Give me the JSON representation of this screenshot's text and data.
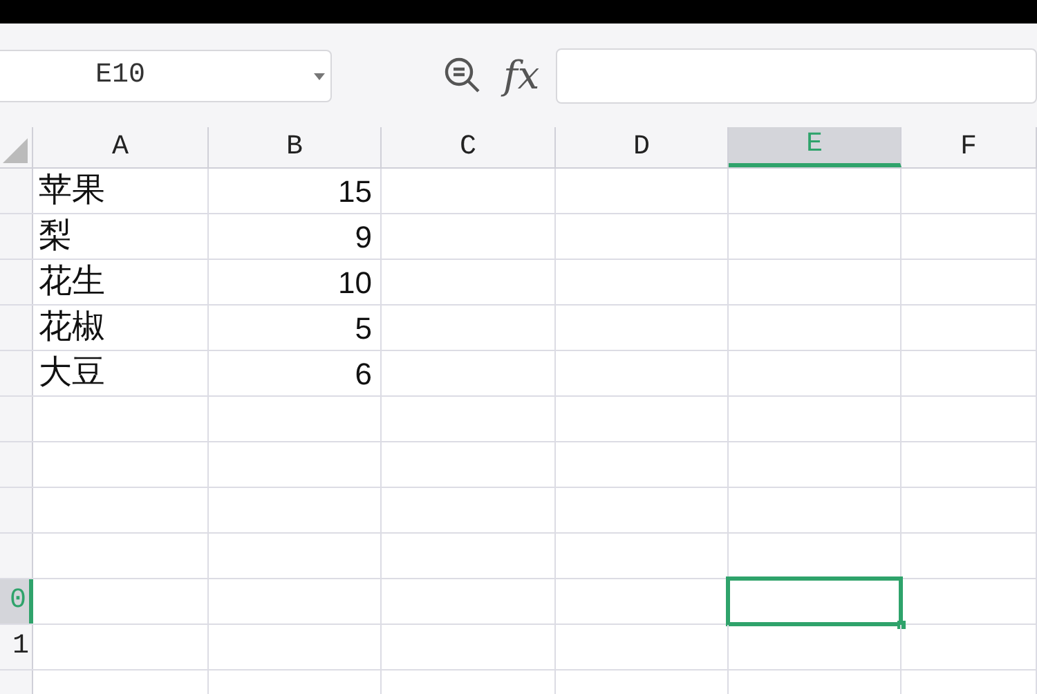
{
  "name_box": {
    "value": "E10"
  },
  "formula_bar": {
    "function_label": "fx"
  },
  "columns": [
    {
      "label": "A",
      "selected": false
    },
    {
      "label": "B",
      "selected": false
    },
    {
      "label": "C",
      "selected": false
    },
    {
      "label": "D",
      "selected": false
    },
    {
      "label": "E",
      "selected": true
    },
    {
      "label": "F",
      "selected": false
    }
  ],
  "rows": [
    {
      "selected": false,
      "cells": [
        "苹果",
        "15"
      ]
    },
    {
      "selected": false,
      "cells": [
        "梨",
        "9"
      ]
    },
    {
      "selected": false,
      "cells": [
        "花生",
        "10"
      ]
    },
    {
      "selected": false,
      "cells": [
        "花椒",
        "5"
      ]
    },
    {
      "selected": false,
      "cells": [
        "大豆",
        "6"
      ]
    },
    {
      "selected": false
    },
    {
      "selected": false
    },
    {
      "selected": false
    },
    {
      "selected": false
    },
    {
      "selected": true,
      "header": "0"
    },
    {
      "selected": false,
      "header": "1"
    },
    {
      "selected": false
    }
  ]
}
